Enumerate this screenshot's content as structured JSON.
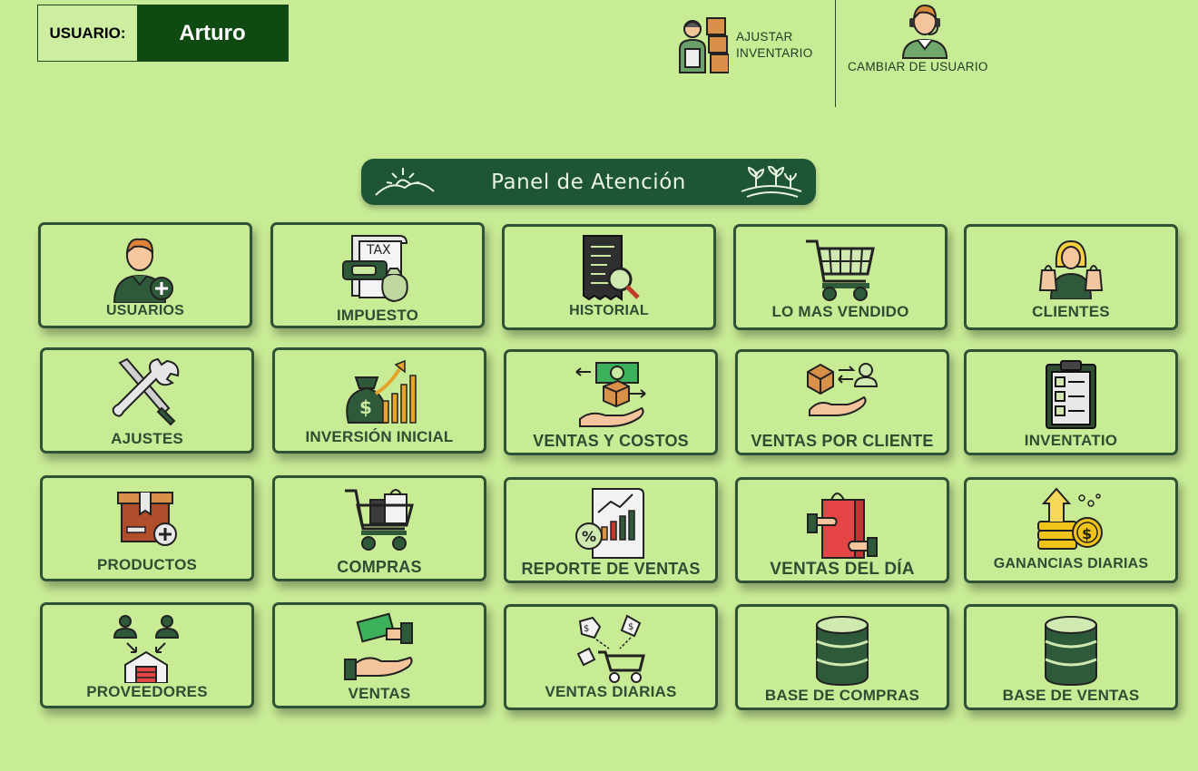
{
  "user": {
    "label": "USUARIO:",
    "name": "Arturo"
  },
  "top_actions": {
    "adjust_line1": "AJUSTAR",
    "adjust_line2": "INVENTARIO",
    "change_user": "CAMBIAR DE USUARIO"
  },
  "panel": {
    "title": "Panel de Atención"
  },
  "tiles": [
    {
      "label": "USUARIOS",
      "icon": "user-add-icon"
    },
    {
      "label": "IMPUESTO",
      "icon": "tax-icon"
    },
    {
      "label": "HISTORIAL",
      "icon": "history-document-icon"
    },
    {
      "label": "LO MAS VENDIDO",
      "icon": "shopping-cart-icon"
    },
    {
      "label": "CLIENTES",
      "icon": "shopper-icon"
    },
    {
      "label": "AJUSTES",
      "icon": "tools-icon"
    },
    {
      "label": "INVERSIÓN INICIAL",
      "icon": "money-bag-growth-icon"
    },
    {
      "label": "VENTAS Y COSTOS",
      "icon": "sales-costs-icon"
    },
    {
      "label": "VENTAS POR CLIENTE",
      "icon": "customer-delivery-icon"
    },
    {
      "label": "INVENTATIO",
      "icon": "clipboard-checklist-icon"
    },
    {
      "label": "PRODUCTOS",
      "icon": "product-box-add-icon"
    },
    {
      "label": "COMPRAS",
      "icon": "cart-bags-icon"
    },
    {
      "label": "REPORTE DE VENTAS",
      "icon": "sales-report-icon"
    },
    {
      "label": "VENTAS DEL DÍA",
      "icon": "shopping-bag-hands-icon"
    },
    {
      "label": "GANANCIAS DIARIAS",
      "icon": "coins-growth-icon"
    },
    {
      "label": "PROVEEDORES",
      "icon": "suppliers-warehouse-icon"
    },
    {
      "label": "VENTAS",
      "icon": "handshake-money-icon"
    },
    {
      "label": "VENTAS DIARIAS",
      "icon": "daily-sales-cart-icon"
    },
    {
      "label": "BASE DE COMPRAS",
      "icon": "database-icon"
    },
    {
      "label": "BASE DE VENTAS",
      "icon": "database-icon"
    }
  ],
  "colors": {
    "background": "#c8eb96",
    "tile_border": "#2f5236",
    "header_bg": "#1f5537",
    "user_bg": "#0f4a13"
  }
}
